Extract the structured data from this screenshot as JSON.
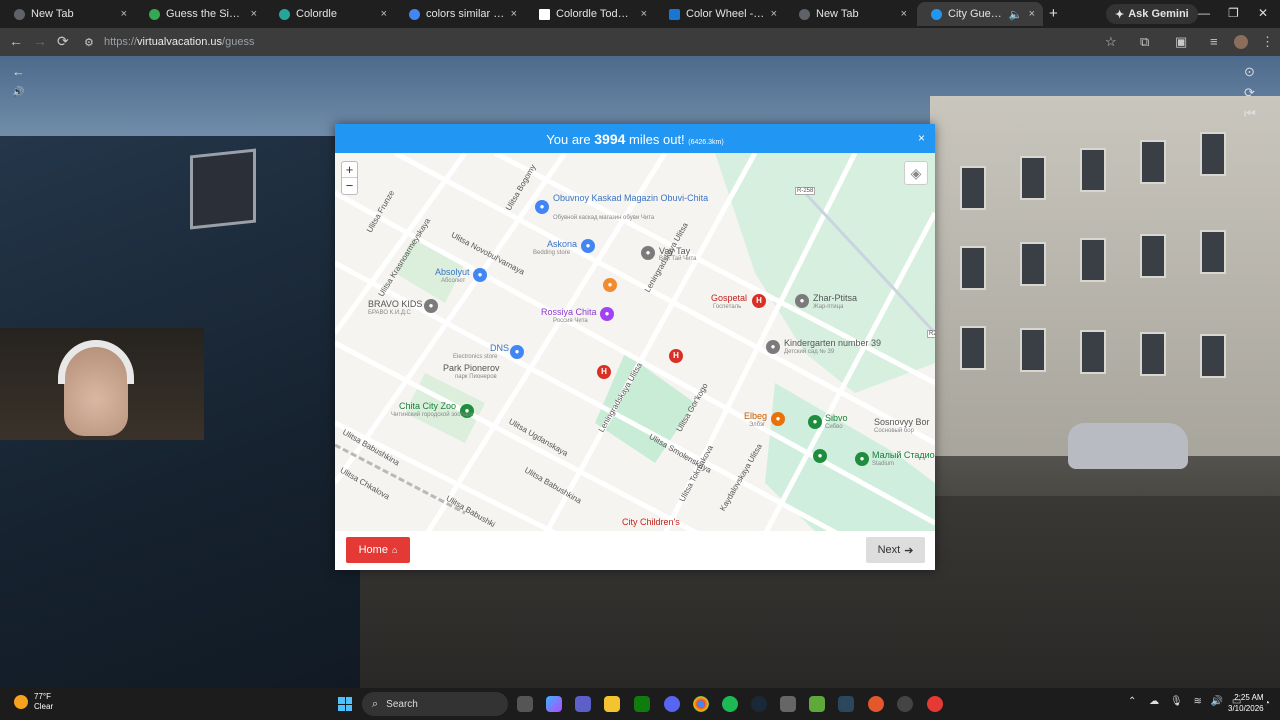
{
  "browser": {
    "tabs": [
      {
        "label": "New Tab",
        "color": "#5f6368",
        "active": false
      },
      {
        "label": "Guess the Size - Worldle",
        "color": "#34a853",
        "active": false
      },
      {
        "label": "Colordle",
        "color": "#26a69a",
        "active": false
      },
      {
        "label": "colors similar to ebony",
        "color": "#4285f4",
        "active": false
      },
      {
        "label": "Colordle Today Answer",
        "color": "#ffffff",
        "active": false
      },
      {
        "label": "Color Wheel - Color Calc",
        "color": "#1976d2",
        "active": false
      },
      {
        "label": "New Tab",
        "color": "#5f6368",
        "active": false
      },
      {
        "label": "City Guesser - Can",
        "color": "#2196f3",
        "active": true
      }
    ],
    "tab_close": "×",
    "new_tab": "+",
    "ask_gemini": "Ask Gemini",
    "url_prefix": "https://",
    "url_host": "virtualvacation.us",
    "url_path": "/guess",
    "window_controls": {
      "minimize": "—",
      "maximize": "❐",
      "close": "✕"
    }
  },
  "modal": {
    "header_prefix": "You are",
    "miles": "3994",
    "header_suffix": "miles out!",
    "km": "(6426.3km)",
    "close": "×",
    "home_label": "Home",
    "next_label": "Next",
    "zoom_in": "+",
    "zoom_out": "−"
  },
  "map": {
    "streets": [
      "Ulitsa Bogomy",
      "Ulitsa Novobul'varnaya",
      "Ulitsa Krasnoarmeyskaya",
      "Ulitsa Frunze",
      "Leningradskaya Ulitsa",
      "Ulitsa Babushkina",
      "Ulitsa Chkalova",
      "Ulitsa Ugdanskaya",
      "Ulitsa Babushki",
      "Ulitsa Smolenskaya",
      "Ulitsa Gor'kogo",
      "Ulitsa Tokmakova",
      "Kaydalovskaya Ulitsa",
      "Ulitsa Babushkina",
      "Ulitsa Ugdanskaya",
      "Leningradskaya Ulitsa"
    ],
    "pois": [
      {
        "name": "Obuvnoy Kaskad Magazin Obuvi-Chita",
        "sub": "Обувной каскад магазин обуви Чита",
        "color": "#4285f4"
      },
      {
        "name": "Askona",
        "sub": "Bedding store",
        "color": "#4285f4"
      },
      {
        "name": "Vay Tay",
        "sub": "Вай Тай Чита",
        "color": "#7b7b7b"
      },
      {
        "name": "Absolyut",
        "sub": "Абсолют",
        "color": "#4285f4"
      },
      {
        "name": "BRAVO KIDS",
        "sub": "БРАВО К.И.Д.С",
        "color": "#7b7b7b"
      },
      {
        "name": "Rossiya Chita",
        "sub": "Россия Чита",
        "color": "#a142f4"
      },
      {
        "name": "Gospetal",
        "sub": "Госпеталь",
        "color": "#d93025"
      },
      {
        "name": "Zhar-Ptitsa",
        "sub": "Жар-птица",
        "color": "#7b7b7b"
      },
      {
        "name": "DNS",
        "sub": "Electronics store",
        "color": "#4285f4"
      },
      {
        "name": "Kindergarten number 39",
        "sub": "Детский сад № 39",
        "color": "#7b7b7b"
      },
      {
        "name": "Park Pionerov",
        "sub": "парк Пионеров",
        "color": "#7b7b7b"
      },
      {
        "name": "Chita City Zoo",
        "sub": "Читинский городской зоопарк",
        "color": "#1e8e3e"
      },
      {
        "name": "Elbeg",
        "sub": "Элбэг",
        "color": "#e8710a"
      },
      {
        "name": "Sibvo",
        "sub": "Сибво",
        "color": "#1e8e3e"
      },
      {
        "name": "Sosnovyy Bor",
        "sub": "Сосновый бор",
        "color": "#7b7b7b"
      },
      {
        "name": "Малый Стадион",
        "sub": "Stadium",
        "color": "#1e8e3e"
      },
      {
        "name": "City Children's",
        "sub": "",
        "color": "#d93025"
      }
    ],
    "road_badges": [
      "R-258",
      "R2"
    ],
    "pin_letter_h": "H"
  },
  "streetview": {
    "back_arrow": "←",
    "sound": "🔊",
    "controls": [
      "⊙",
      "⟳",
      "⏮"
    ]
  },
  "taskbar": {
    "temperature": "77°F",
    "weather": "Clear",
    "search_placeholder": "Search",
    "time": "2:25 AM",
    "date": "3/10/2026",
    "tray_chevron": "⌃"
  }
}
